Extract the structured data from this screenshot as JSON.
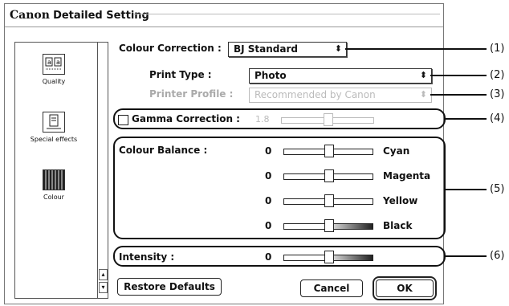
{
  "window": {
    "brand": "Canon",
    "title": "Detailed Setting"
  },
  "sidebar": {
    "items": [
      {
        "label": "Quality",
        "icon": "quality-icon"
      },
      {
        "label": "Special effects",
        "icon": "special-effects-icon"
      },
      {
        "label": "Colour",
        "icon": "colour-icon",
        "selected": true
      }
    ]
  },
  "colour_correction": {
    "label": "Colour Correction :",
    "value": "BJ Standard"
  },
  "print_type": {
    "label": "Print Type :",
    "value": "Photo"
  },
  "printer_profile": {
    "label": "Printer Profile :",
    "value": "Recommended by Canon"
  },
  "gamma": {
    "label": "Gamma Correction :",
    "value": "1.8",
    "checked": false,
    "level": 0.5
  },
  "colour_balance": {
    "label": "Colour Balance :",
    "channels": [
      {
        "name": "Cyan",
        "value": "0",
        "level": 0.5
      },
      {
        "name": "Magenta",
        "value": "0",
        "level": 0.5
      },
      {
        "name": "Yellow",
        "value": "0",
        "level": 0.5
      },
      {
        "name": "Black",
        "value": "0",
        "level": 0.5
      }
    ]
  },
  "intensity": {
    "label": "Intensity :",
    "value": "0",
    "level": 0.5
  },
  "buttons": {
    "restore": "Restore Defaults",
    "cancel": "Cancel",
    "ok": "OK"
  },
  "callouts": [
    "(1)",
    "(2)",
    "(3)",
    "(4)",
    "(5)",
    "(6)"
  ]
}
